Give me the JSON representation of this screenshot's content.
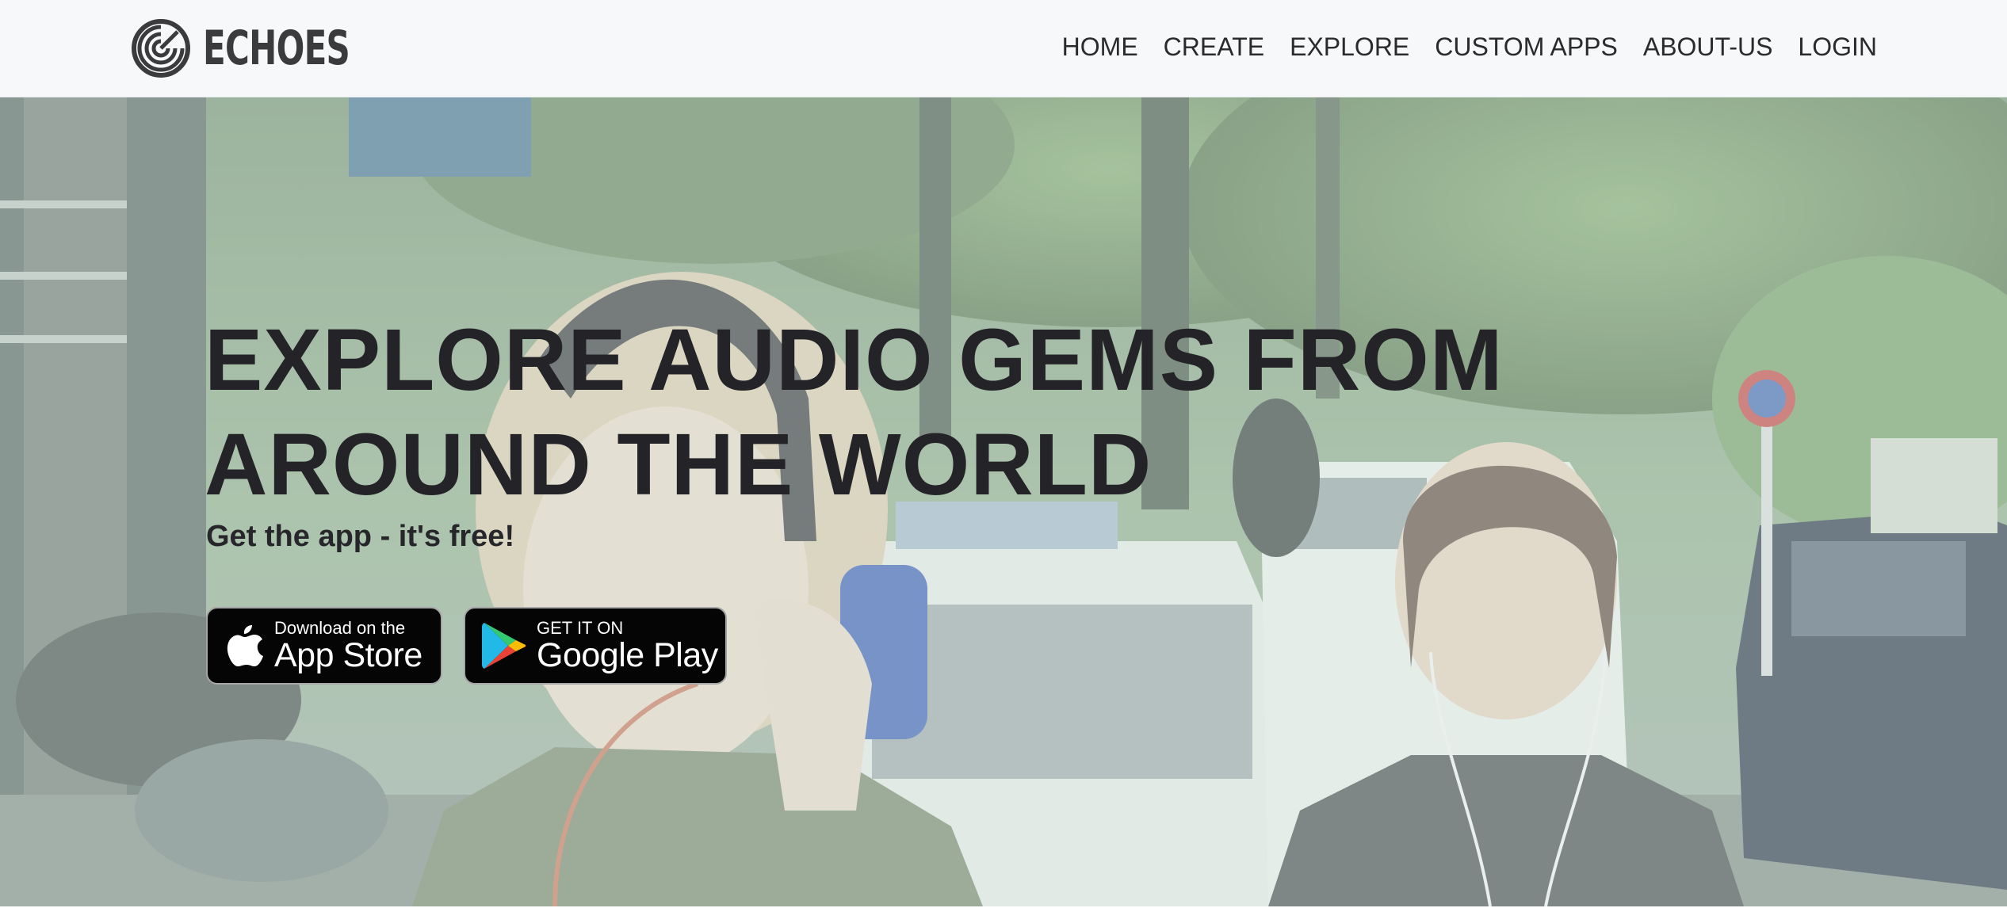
{
  "brand": {
    "name": "ECHOES",
    "icon": "echoes-logo-icon"
  },
  "nav": {
    "items": [
      {
        "label": "HOME"
      },
      {
        "label": "CREATE"
      },
      {
        "label": "EXPLORE"
      },
      {
        "label": "CUSTOM APPS"
      },
      {
        "label": "ABOUT-US"
      },
      {
        "label": "LOGIN"
      }
    ]
  },
  "hero": {
    "title": "EXPLORE AUDIO GEMS FROM AROUND THE WORLD",
    "subtitle": "Get the app - it's free!",
    "app_store": {
      "small": "Download on the",
      "big": "App Store",
      "icon": "apple-icon"
    },
    "google_play": {
      "small": "GET IT ON",
      "big": "Google Play",
      "icon": "google-play-icon"
    }
  },
  "colors": {
    "navbar_bg": "#f7f8fa",
    "nav_text": "#2b2b2e",
    "hero_text": "#242428",
    "badge_bg": "#050505"
  }
}
